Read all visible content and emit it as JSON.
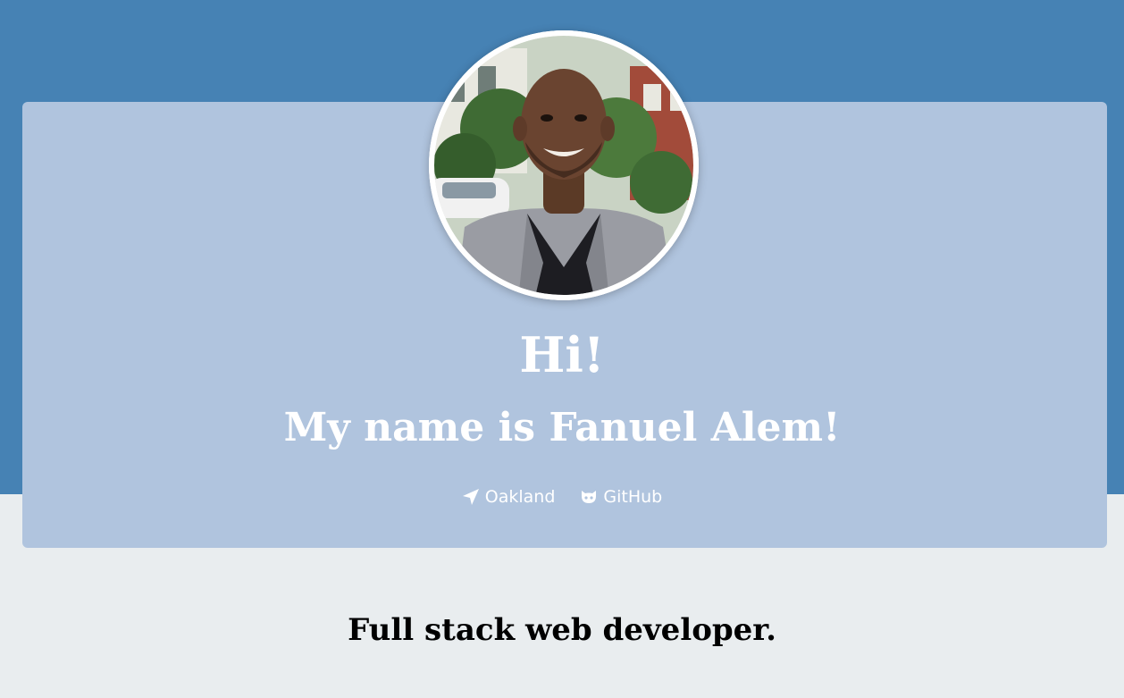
{
  "hero": {
    "greeting": "Hi!",
    "name_line": "My name is Fanuel Alem!"
  },
  "links": {
    "location_label": "Oakland",
    "location_icon": "location-arrow-icon",
    "github_label": "GitHub",
    "github_icon": "github-icon"
  },
  "about": {
    "tagline": "Full stack web developer."
  },
  "colors": {
    "header_band": "#4682b4",
    "card": "#b0c4de",
    "page_background": "#e9edef",
    "text_light": "#ffffff",
    "text_dark": "#000000"
  }
}
